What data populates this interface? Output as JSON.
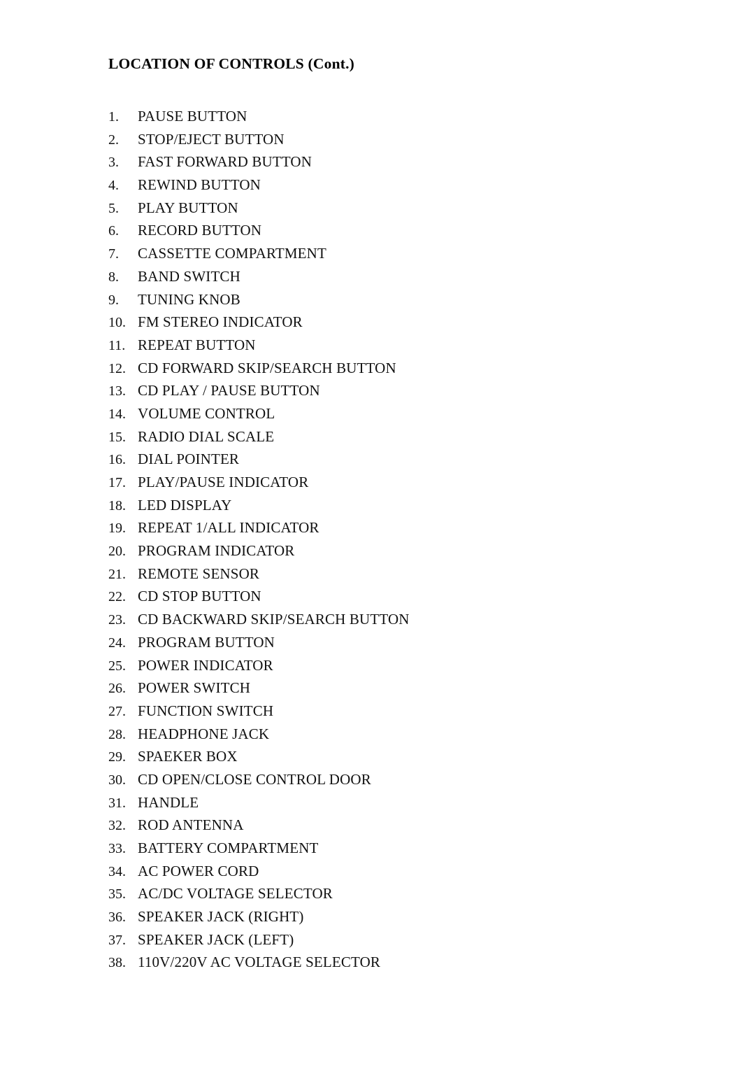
{
  "document": {
    "title": "LOCATION OF CONTROLS (Cont.)",
    "background_color": "#ffffff",
    "text_color": "#000000"
  },
  "controls": [
    {
      "number": "1.",
      "label": "PAUSE BUTTON"
    },
    {
      "number": "2.",
      "label": "STOP/EJECT BUTTON"
    },
    {
      "number": "3.",
      "label": "FAST FORWARD BUTTON"
    },
    {
      "number": "4.",
      "label": "REWIND BUTTON"
    },
    {
      "number": "5.",
      "label": "PLAY BUTTON"
    },
    {
      "number": "6.",
      "label": "RECORD BUTTON"
    },
    {
      "number": "7.",
      "label": "CASSETTE COMPARTMENT"
    },
    {
      "number": "8.",
      "label": "BAND SWITCH"
    },
    {
      "number": "9.",
      "label": "TUNING KNOB"
    },
    {
      "number": "10.",
      "label": "FM STEREO INDICATOR"
    },
    {
      "number": "11.",
      "label": "REPEAT BUTTON"
    },
    {
      "number": "12.",
      "label": "CD FORWARD SKIP/SEARCH BUTTON"
    },
    {
      "number": "13.",
      "label": "CD PLAY / PAUSE BUTTON"
    },
    {
      "number": "14.",
      "label": "VOLUME CONTROL"
    },
    {
      "number": "15.",
      "label": "RADIO DIAL SCALE"
    },
    {
      "number": "16.",
      "label": "DIAL POINTER"
    },
    {
      "number": "17.",
      "label": "PLAY/PAUSE INDICATOR"
    },
    {
      "number": "18.",
      "label": "LED DISPLAY"
    },
    {
      "number": "19.",
      "label": "REPEAT 1/ALL INDICATOR"
    },
    {
      "number": "20.",
      "label": "PROGRAM INDICATOR"
    },
    {
      "number": "21.",
      "label": "REMOTE SENSOR"
    },
    {
      "number": "22.",
      "label": "CD STOP BUTTON"
    },
    {
      "number": "23.",
      "label": "CD BACKWARD SKIP/SEARCH BUTTON"
    },
    {
      "number": "24.",
      "label": "PROGRAM BUTTON"
    },
    {
      "number": "25.",
      "label": "POWER INDICATOR"
    },
    {
      "number": "26.",
      "label": "POWER SWITCH"
    },
    {
      "number": "27.",
      "label": "FUNCTION SWITCH"
    },
    {
      "number": "28.",
      "label": "HEADPHONE JACK"
    },
    {
      "number": "29.",
      "label": "SPAEKER BOX"
    },
    {
      "number": "30.",
      "label": "CD OPEN/CLOSE CONTROL DOOR"
    },
    {
      "number": "31.",
      "label": "HANDLE"
    },
    {
      "number": "32.",
      "label": "ROD ANTENNA"
    },
    {
      "number": "33.",
      "label": "BATTERY COMPARTMENT"
    },
    {
      "number": "34.",
      "label": "AC POWER CORD"
    },
    {
      "number": "35.",
      "label": "AC/DC VOLTAGE SELECTOR"
    },
    {
      "number": "36.",
      "label": "SPEAKER JACK (RIGHT)"
    },
    {
      "number": "37.",
      "label": "SPEAKER JACK (LEFT)"
    },
    {
      "number": "38.",
      "label": "110V/220V AC VOLTAGE SELECTOR"
    }
  ]
}
